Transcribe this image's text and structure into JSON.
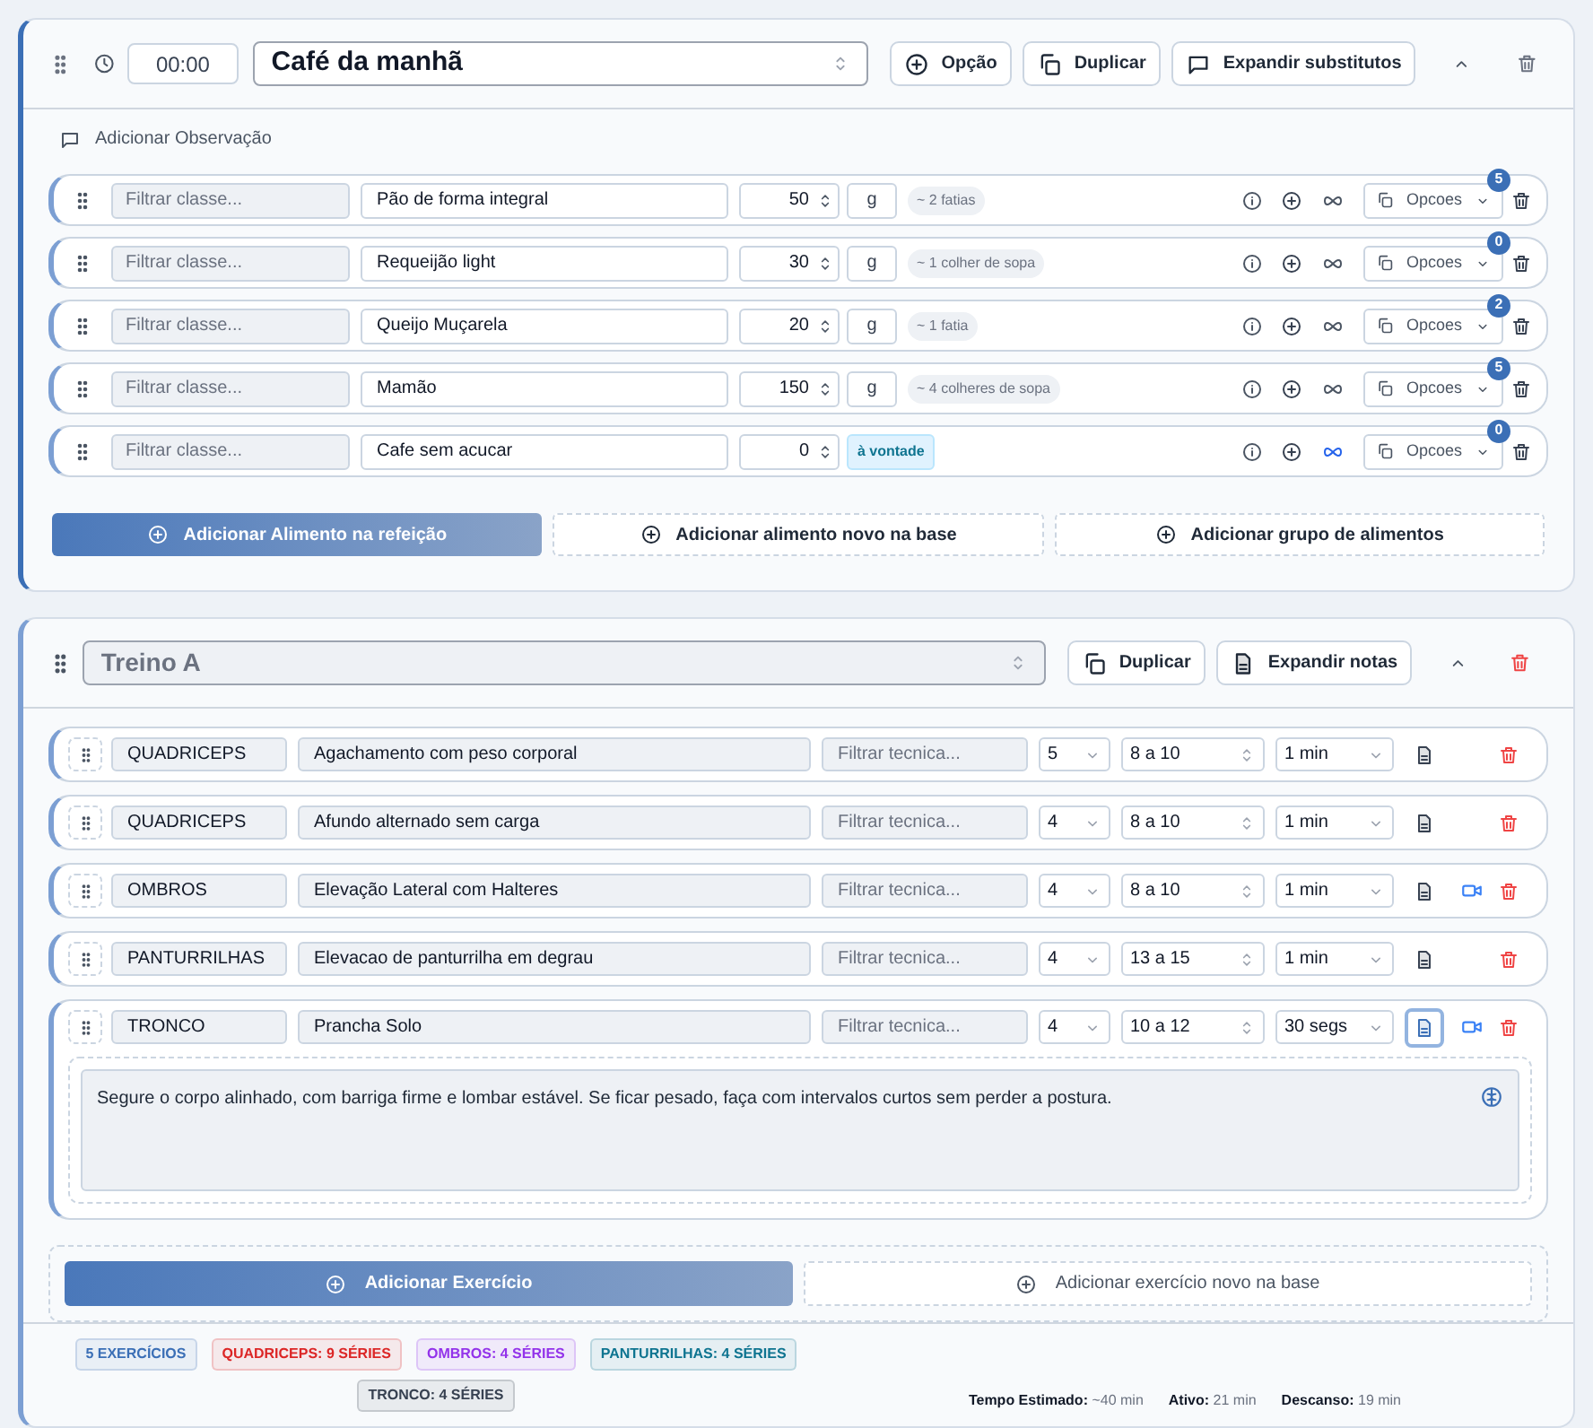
{
  "meal": {
    "time": "00:00",
    "title": "Café da manhã",
    "buttons": [
      "Opção",
      "Duplicar",
      "Expandir substitutos"
    ],
    "observation": "Adicionar Observação",
    "foods": [
      {
        "kind": "measured",
        "class_placeholder": "Filtrar classe...",
        "name": "Pão de forma integral",
        "qty": "50",
        "unit": "g",
        "portion": "~ 2 fatias",
        "linked": false,
        "options": "Opcoes",
        "count": "5"
      },
      {
        "kind": "measured",
        "class_placeholder": "Filtrar classe...",
        "name": "Requeijão light",
        "qty": "30",
        "unit": "g",
        "portion": "~ 1 colher de sopa",
        "linked": false,
        "options": "Opcoes",
        "count": "0"
      },
      {
        "kind": "measured",
        "class_placeholder": "Filtrar classe...",
        "name": "Queijo Muçarela",
        "qty": "20",
        "unit": "g",
        "portion": "~ 1 fatia",
        "linked": false,
        "options": "Opcoes",
        "count": "2"
      },
      {
        "kind": "measured",
        "class_placeholder": "Filtrar classe...",
        "name": "Mamão",
        "qty": "150",
        "unit": "g",
        "portion": "~ 4 colheres de sopa",
        "linked": false,
        "options": "Opcoes",
        "count": "5"
      },
      {
        "kind": "free",
        "class_placeholder": "Filtrar classe...",
        "name": "Cafe sem acucar",
        "qty": "0",
        "portion": "à vontade",
        "linked": true,
        "options": "Opcoes",
        "count": "0"
      }
    ],
    "add_buttons": [
      "Adicionar Alimento na refeição",
      "Adicionar alimento novo na base",
      "Adicionar grupo de alimentos"
    ]
  },
  "workout": {
    "title": "Treino A",
    "buttons": [
      "Duplicar",
      "Expandir notas"
    ],
    "exercises": [
      {
        "group": "QUADRICEPS",
        "name": "Agachamento com peso corporal",
        "technique_placeholder": "Filtrar tecnica...",
        "sets": "5",
        "reps": "8 a 10",
        "rest": "1 min",
        "video": false,
        "notes_open": false
      },
      {
        "group": "QUADRICEPS",
        "name": "Afundo alternado sem carga",
        "technique_placeholder": "Filtrar tecnica...",
        "sets": "4",
        "reps": "8 a 10",
        "rest": "1 min",
        "video": false,
        "notes_open": false
      },
      {
        "group": "OMBROS",
        "name": "Elevação Lateral com Halteres",
        "technique_placeholder": "Filtrar tecnica...",
        "sets": "4",
        "reps": "8 a 10",
        "rest": "1 min",
        "video": true,
        "notes_open": false
      },
      {
        "group": "PANTURRILHAS",
        "name": "Elevacao de panturrilha em degrau",
        "technique_placeholder": "Filtrar tecnica...",
        "sets": "4",
        "reps": "13 a 15",
        "rest": "1 min",
        "video": false,
        "notes_open": false
      },
      {
        "group": "TRONCO",
        "name": "Prancha Solo",
        "technique_placeholder": "Filtrar tecnica...",
        "sets": "4",
        "reps": "10 a 12",
        "rest": "30 segs",
        "video": true,
        "notes_open": true,
        "note": "Segure o corpo alinhado, com barriga firme e lombar estável. Se ficar pesado, faça com intervalos curtos sem perder a postura."
      }
    ],
    "add_buttons": [
      "Adicionar Exercício",
      "Adicionar exercício novo na base"
    ],
    "tags": [
      {
        "text": "5 EXERCÍCIOS",
        "color": "#3b6fb6"
      },
      {
        "text": "QUADRICEPS: 9 SÉRIES",
        "color": "#dc2626"
      },
      {
        "text": "OMBROS: 4 SÉRIES",
        "color": "#9333ea"
      },
      {
        "text": "PANTURRILHAS: 4 SÉRIES",
        "color": "#0e7490"
      },
      {
        "text": "TRONCO: 4 SÉRIES",
        "color": "#374151"
      }
    ],
    "stats": [
      {
        "label": "Tempo Estimado:",
        "value": "~40 min"
      },
      {
        "label": "Ativo:",
        "value": "21 min"
      },
      {
        "label": "Descanso:",
        "value": "19 min"
      }
    ]
  }
}
